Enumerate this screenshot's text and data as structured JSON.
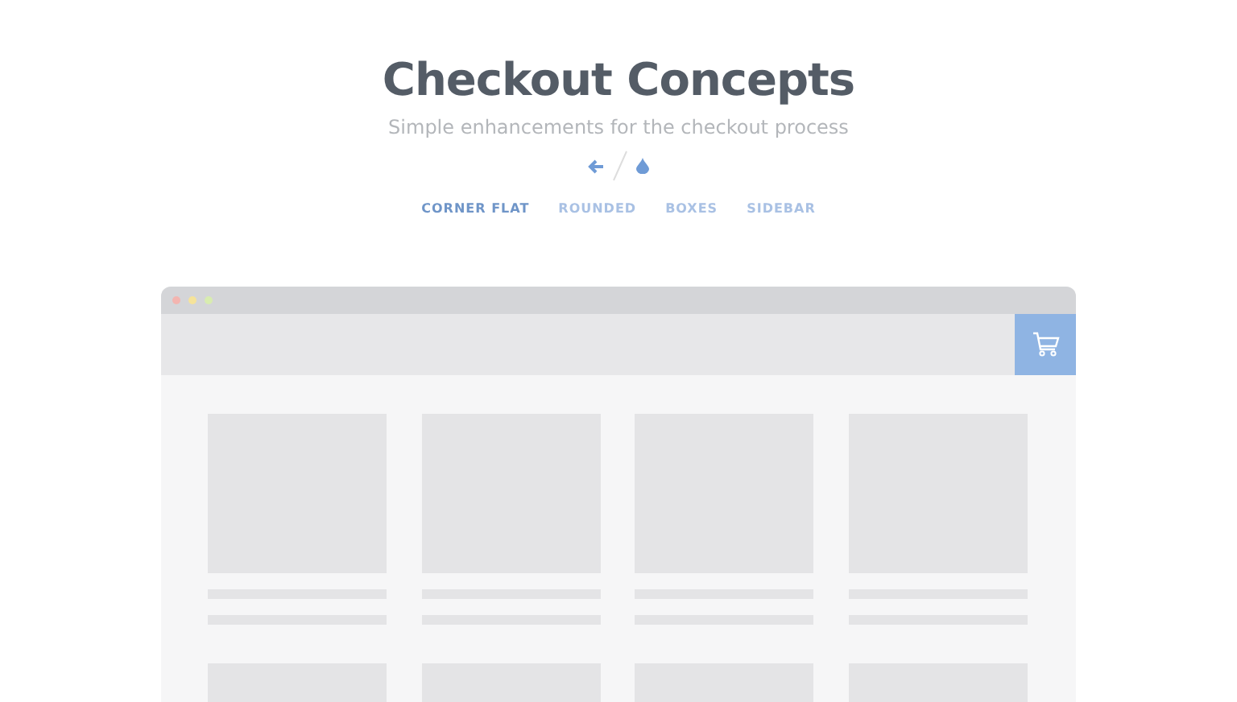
{
  "header": {
    "title": "Checkout Concepts",
    "subtitle": "Simple enhancements for the checkout process"
  },
  "nav": [
    {
      "label": "CORNER FLAT",
      "selected": true
    },
    {
      "label": "ROUNDED",
      "selected": false
    },
    {
      "label": "BOXES",
      "selected": false
    },
    {
      "label": "SIDEBAR",
      "selected": false
    }
  ],
  "mockup": {
    "cards": [
      {
        "kind": "placeholder"
      },
      {
        "kind": "placeholder"
      },
      {
        "kind": "placeholder"
      },
      {
        "kind": "placeholder"
      },
      {
        "kind": "image"
      },
      {
        "kind": "image"
      },
      {
        "kind": "image"
      },
      {
        "kind": "image"
      }
    ]
  }
}
